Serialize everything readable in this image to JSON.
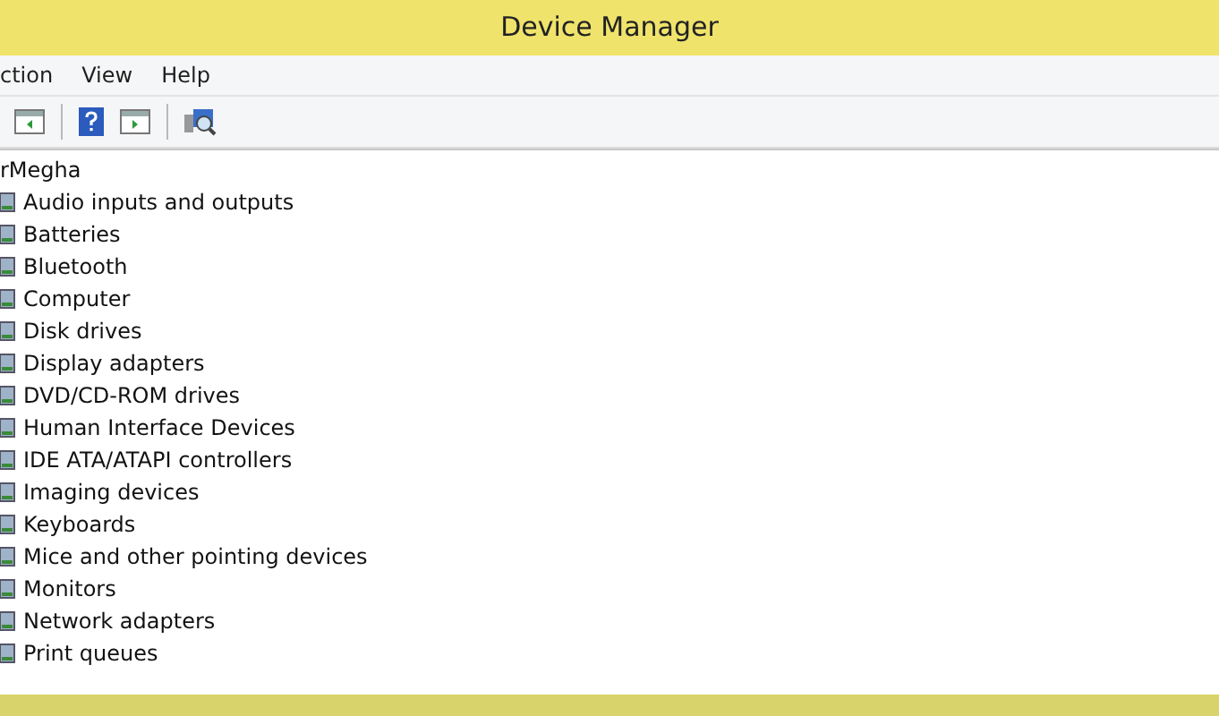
{
  "window": {
    "title": "Device Manager"
  },
  "menu": [
    {
      "label": "ction"
    },
    {
      "label": "View"
    },
    {
      "label": "Help"
    }
  ],
  "tree": {
    "root": "rMegha",
    "children": [
      {
        "label": "Audio inputs and outputs"
      },
      {
        "label": "Batteries"
      },
      {
        "label": "Bluetooth"
      },
      {
        "label": "Computer"
      },
      {
        "label": "Disk drives"
      },
      {
        "label": "Display adapters"
      },
      {
        "label": "DVD/CD-ROM drives"
      },
      {
        "label": "Human Interface Devices"
      },
      {
        "label": "IDE ATA/ATAPI controllers"
      },
      {
        "label": "Imaging devices"
      },
      {
        "label": "Keyboards"
      },
      {
        "label": "Mice and other pointing devices"
      },
      {
        "label": "Monitors"
      },
      {
        "label": "Network adapters"
      },
      {
        "label": "Print queues"
      }
    ]
  }
}
